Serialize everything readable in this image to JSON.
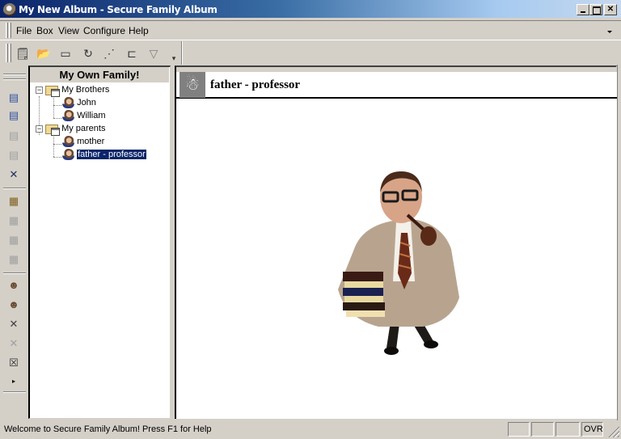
{
  "window": {
    "title": "My New Album - Secure Family Album",
    "controls": {
      "minimize": "minimize",
      "maximize": "maximize",
      "close": "✕"
    }
  },
  "menubar": {
    "items": [
      {
        "label": "File"
      },
      {
        "label": "Box"
      },
      {
        "label": "View"
      },
      {
        "label": "Configure"
      },
      {
        "label": "Help"
      }
    ]
  },
  "toolbar": {
    "buttons": [
      {
        "name": "new-album",
        "glyph": "🗒"
      },
      {
        "name": "open-album",
        "glyph": "📂"
      },
      {
        "name": "save",
        "glyph": "▭"
      },
      {
        "name": "undo",
        "glyph": "↻"
      },
      {
        "name": "chart",
        "glyph": "⋰"
      },
      {
        "name": "tree",
        "glyph": "⊏"
      },
      {
        "name": "filter",
        "glyph": "▽"
      }
    ],
    "overflow_glyph": "▾"
  },
  "sidebar": {
    "icons": [
      {
        "name": "box-icon",
        "glyph": "▤"
      },
      {
        "name": "box-key-icon",
        "glyph": "▤"
      },
      {
        "name": "box-disabled-icon",
        "glyph": "▤"
      },
      {
        "name": "box-disabled-2-icon",
        "glyph": "▤"
      },
      {
        "name": "box-delete-icon",
        "glyph": "✕"
      },
      {
        "name": "folder-add-icon",
        "glyph": "▦"
      },
      {
        "name": "folder-disabled-icon",
        "glyph": "▦"
      },
      {
        "name": "folder-key-disabled-icon",
        "glyph": "▦"
      },
      {
        "name": "folder-delete-disabled-icon",
        "glyph": "▦"
      },
      {
        "name": "person-add-icon",
        "glyph": "☻"
      },
      {
        "name": "person-key-icon",
        "glyph": "☻"
      },
      {
        "name": "cut-icon",
        "glyph": "✕"
      },
      {
        "name": "cut-disabled-icon",
        "glyph": "✕"
      },
      {
        "name": "person-delete-icon",
        "glyph": "☒"
      },
      {
        "name": "more-icon",
        "glyph": "▸"
      }
    ]
  },
  "tree": {
    "header": "My Own Family!",
    "groups": [
      {
        "label": "My Brothers",
        "expanded": true,
        "children": [
          {
            "label": "John"
          },
          {
            "label": "William"
          }
        ]
      },
      {
        "label": "My parents",
        "expanded": true,
        "children": [
          {
            "label": "mother"
          },
          {
            "label": "father - professor",
            "selected": true
          }
        ]
      }
    ],
    "expand_glyph": "−"
  },
  "content": {
    "title": "father - professor",
    "header_icon_glyph": "☃",
    "photo_alt": "Man in glasses with a pipe and cardigan holding a stack of books"
  },
  "statusbar": {
    "text": "Welcome to Secure Family Album! Press F1 for Help",
    "panels": [
      "",
      "",
      "",
      "OVR"
    ]
  }
}
